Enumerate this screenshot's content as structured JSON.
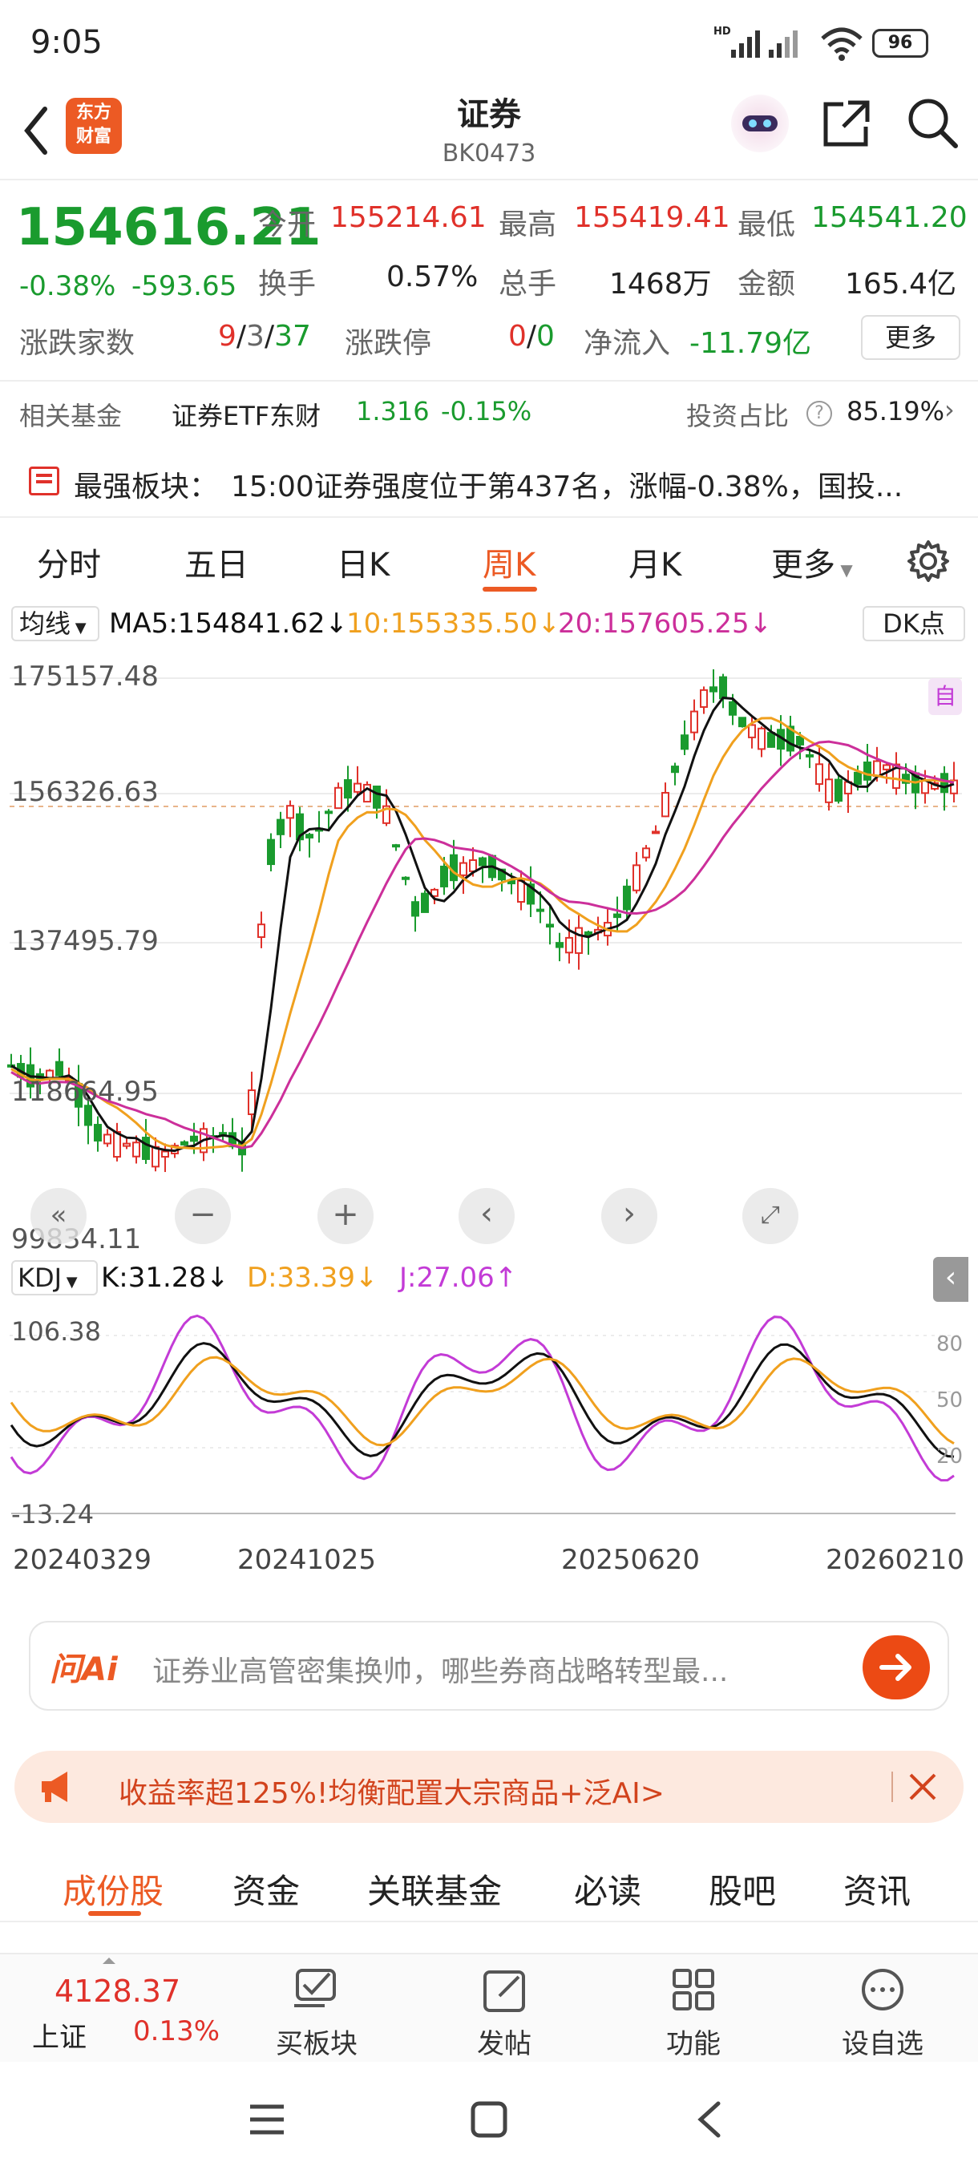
{
  "status": {
    "time": "9:05",
    "hd": "HD",
    "battery": "96"
  },
  "nav": {
    "logo_line1": "东方",
    "logo_line2": "财富",
    "title": "证券",
    "subtitle": "BK0473"
  },
  "quote": {
    "price": "154616.21",
    "change_pct": "-0.38%",
    "change_abs": "-593.65",
    "open_label": "今开",
    "open": "155214.61",
    "high_label": "最高",
    "high": "155419.41",
    "low_label": "最低",
    "low": "154541.20",
    "turnover_label": "换手",
    "turnover": "0.57%",
    "volume_label": "总手",
    "volume": "1468万",
    "amount_label": "金额",
    "amount": "165.4亿",
    "breadth_label": "涨跌家数",
    "up": "9",
    "sep": "/",
    "flat": "3",
    "down": "37",
    "limit_label": "涨跌停",
    "limit_up": "0",
    "limit_down": "0",
    "inflow_label": "净流入",
    "inflow": "-11.79亿",
    "more_button": "更多"
  },
  "fund": {
    "label": "相关基金",
    "name": "证券ETF东财",
    "nav": "1.316",
    "change": "-0.15%",
    "ratio_label": "投资占比",
    "ratio": "85.19%"
  },
  "strong": {
    "label": "最强板块：",
    "text": "15:00证券强度位于第437名，涨幅-0.38%，国投..."
  },
  "tabs": [
    "分时",
    "五日",
    "日K",
    "周K",
    "月K",
    "更多"
  ],
  "tabs_active": 3,
  "chart": {
    "ma_selector": "均线",
    "ma5": "MA5:154841.62",
    "ma10": "10:155335.50",
    "ma20": "20:157605.25",
    "dk_button": "DK点",
    "self_label": "自",
    "price_labels": [
      "175157.48",
      "156326.63",
      "137495.79",
      "118664.95",
      "99834.11"
    ],
    "kdj_selector": "KDJ",
    "k": "K:31.28",
    "d": "D:33.39",
    "j": "J:27.06",
    "kdj_top": "106.38",
    "kdj_bottom": "-13.24",
    "kdj_levels": [
      "80",
      "50",
      "20"
    ],
    "dates": [
      "20240329",
      "20241025",
      "20250620",
      "20260210"
    ],
    "colors": {
      "up": "#e0312a",
      "down": "#1a9b2e",
      "ma5": "#111111",
      "ma10": "#f0a01e",
      "ma20": "#cc2f9a",
      "j": "#c33bd6"
    }
  },
  "ai": {
    "brand": "问Ai",
    "placeholder": "证券业高管密集换帅，哪些券商战略转型最..."
  },
  "promo": {
    "text": "收益率超125%!均衡配置大宗商品+泛AI>"
  },
  "subtabs": [
    "成份股",
    "资金",
    "关联基金",
    "必读",
    "股吧",
    "资讯"
  ],
  "bottom": {
    "index_value": "4128.37",
    "index_name": "上证",
    "index_change": "0.13%",
    "items": [
      "买板块",
      "发帖",
      "功能",
      "设自选"
    ]
  }
}
